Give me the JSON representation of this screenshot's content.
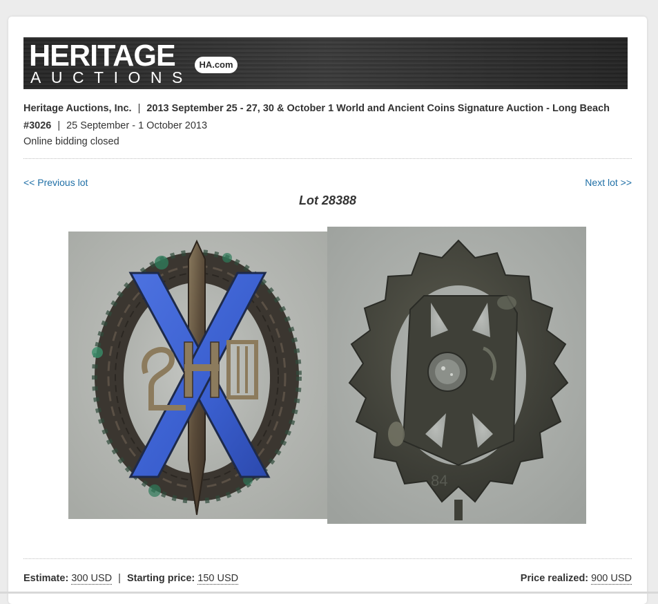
{
  "brand": {
    "logo_main": "HERITAGE",
    "logo_sub": "AUCTIONS",
    "logo_badge": "HA.com"
  },
  "auction": {
    "house": "Heritage Auctions, Inc.",
    "separator": "|",
    "title": "2013 September 25 - 27, 30 & October 1 World and Ancient Coins Signature Auction - Long Beach",
    "number": "#3026",
    "dates": "25 September - 1 October 2013",
    "status": "Online bidding closed"
  },
  "nav": {
    "previous": "<< Previous lot",
    "next": "Next lot >>"
  },
  "lot": {
    "title": "Lot 28388",
    "reverse_mark": "84"
  },
  "pricing": {
    "estimate_label": "Estimate:",
    "estimate_value": "300 USD",
    "starting_label": "Starting price:",
    "starting_value": "150 USD",
    "realized_label": "Price realized:",
    "realized_value": "900 USD"
  },
  "colors": {
    "link": "#1f6fa6",
    "enamel": "#3a5fcf"
  }
}
